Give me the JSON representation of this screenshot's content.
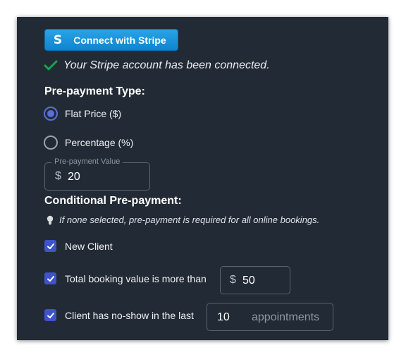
{
  "stripe": {
    "button_label": "Connect with Stripe",
    "logo_letter": "S",
    "status_text": "Your Stripe account has been connected.",
    "brand_color": "#1a8fd8"
  },
  "prepayment_type": {
    "title": "Pre-payment Type:",
    "options": [
      {
        "label": "Flat Price ($)",
        "selected": true
      },
      {
        "label": "Percentage (%)",
        "selected": false
      }
    ],
    "value_field": {
      "legend": "Pre-payment Value",
      "prefix": "$",
      "value": "20"
    }
  },
  "conditional": {
    "title": "Conditional Pre-payment:",
    "hint": "If none selected, pre-payment is required for all online bookings.",
    "conditions": [
      {
        "label": "New Client",
        "checked": true
      },
      {
        "label": "Total booking value is more than",
        "checked": true,
        "prefix": "$",
        "value": "50"
      },
      {
        "label": "Client has no-show in the last",
        "checked": true,
        "value": "10",
        "unit": "appointments"
      }
    ]
  },
  "colors": {
    "panel_bg": "#222b35",
    "accent": "#3e54c8",
    "success": "#1aa34a"
  }
}
